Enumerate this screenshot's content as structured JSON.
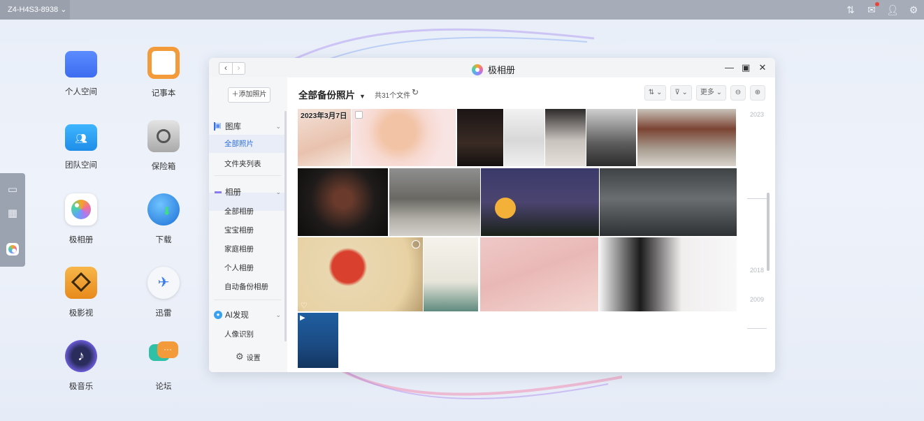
{
  "topbar": {
    "device_name": "Z4-H4S3-8938",
    "icons": [
      "transfer-icon",
      "mail-icon",
      "user-icon",
      "gear-icon"
    ]
  },
  "desktop": {
    "apps": [
      {
        "label": "个人空间",
        "icon": "folder-icon"
      },
      {
        "label": "记事本",
        "icon": "notepad-icon"
      },
      {
        "label": "团队空间",
        "icon": "team-folder-icon"
      },
      {
        "label": "保险箱",
        "icon": "safe-icon"
      },
      {
        "label": "极相册",
        "icon": "photos-icon"
      },
      {
        "label": "下载",
        "icon": "download-icon"
      },
      {
        "label": "极影视",
        "icon": "video-icon"
      },
      {
        "label": "迅雷",
        "icon": "thunder-icon"
      },
      {
        "label": "极音乐",
        "icon": "music-icon"
      },
      {
        "label": "论坛",
        "icon": "forum-icon"
      }
    ]
  },
  "window": {
    "title": "极相册",
    "sidebar": {
      "add_photo": "添加照片",
      "gallery": {
        "label": "图库",
        "items": [
          "全部照片",
          "文件夹列表"
        ]
      },
      "albums": {
        "label": "相册",
        "items": [
          "全部相册",
          "宝宝相册",
          "家庭相册",
          "个人相册",
          "自动备份相册"
        ]
      },
      "ai": {
        "label": "AI发现",
        "items": [
          "人像识别"
        ]
      },
      "settings": "设置"
    },
    "main": {
      "title": "全部备份照片",
      "count": "共31个文件",
      "more": "更多",
      "date_group": "2023年3月7日",
      "timeline_years": [
        "2023",
        "2018",
        "2009"
      ]
    }
  },
  "colors": {
    "accent": "#2f6fe0",
    "topbar": "#a6adb9"
  }
}
